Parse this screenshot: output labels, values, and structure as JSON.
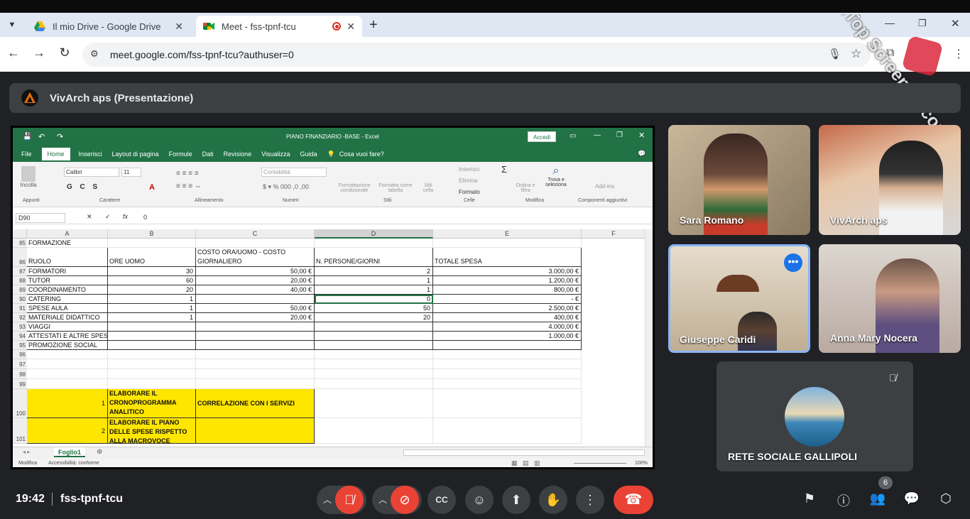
{
  "browser": {
    "tabs": [
      {
        "title": "Il mio Drive - Google Drive"
      },
      {
        "title": "Meet - fss-tpnf-tcu"
      }
    ],
    "url": "meet.google.com/fss-tpnf-tcu?authuser=0",
    "watermark": "iTop Screen Recorder"
  },
  "meet": {
    "presentation_title": "VivArch aps (Presentazione)",
    "time": "19:42",
    "meeting_code": "fss-tpnf-tcu",
    "participants_count": "6",
    "participants": [
      {
        "name": "Sara Romano"
      },
      {
        "name": "VivArch aps"
      },
      {
        "name": "Giuseppe Caridi"
      },
      {
        "name": "Anna Mary Nocera"
      },
      {
        "name": "RETE SOCIALE GALLIPOLI"
      }
    ]
  },
  "excel": {
    "title": "PIANO FINANZIARIO -BASE  -  Excel",
    "sign_in": "Accedi",
    "menu": [
      "File",
      "Home",
      "Inserisci",
      "Layout di pagina",
      "Formule",
      "Dati",
      "Revisione",
      "Visualizza",
      "Guida"
    ],
    "tell_me": "Cosa vuoi fare?",
    "ribbon": {
      "paste": "Incolla",
      "font_name": "Calibri",
      "font_size": "11",
      "number_format": "Contabilità",
      "cond_format": "Formattazione condizionale",
      "format_table": "Formatta come tabella",
      "cell_styles": "Stili cella",
      "insert": "Inserisci",
      "delete": "Elimina",
      "format": "Formato",
      "sort_filter": "Ordina e filtra",
      "find_select": "Trova e seleziona",
      "addins": "Add-ins",
      "groups": [
        "Appunti",
        "Carattere",
        "Allineamento",
        "Numeri",
        "Stili",
        "Celle",
        "Modifica",
        "Componenti aggiuntivi"
      ]
    },
    "name_box": "D90",
    "formula": "0",
    "columns": [
      "A",
      "B",
      "C",
      "D",
      "E",
      "F"
    ],
    "rows": [
      {
        "n": "85",
        "a": "FORMAZIONE",
        "b": "",
        "c": "",
        "d": "",
        "e": ""
      },
      {
        "n": "86",
        "a": "RUOLO",
        "b": "ORE UOMO",
        "c": "COSTO ORA/UOMO - COSTO GIORNALIERO",
        "d": "N. PERSONE/GIORNI",
        "e": "TOTALE SPESA"
      },
      {
        "n": "87",
        "a": "FORMATORI",
        "b": "30",
        "c": "50,00 €",
        "d": "2",
        "e": "3.000,00 €"
      },
      {
        "n": "88",
        "a": "TUTOR",
        "b": "60",
        "c": "20,00 €",
        "d": "1",
        "e": "1.200,00 €"
      },
      {
        "n": "89",
        "a": "COORDINAMENTO",
        "b": "20",
        "c": "40,00 €",
        "d": "1",
        "e": "800,00 €"
      },
      {
        "n": "90",
        "a": "CATERING",
        "b": "1",
        "c": "",
        "d": "0",
        "e": "-     €"
      },
      {
        "n": "91",
        "a": "SPESE AULA",
        "b": "1",
        "c": "50,00 €",
        "d": "50",
        "e": "2.500,00 €"
      },
      {
        "n": "92",
        "a": "MATERIALE DIDATTICO",
        "b": "1",
        "c": "20,00 €",
        "d": "20",
        "e": "400,00 €"
      },
      {
        "n": "93",
        "a": "VIAGGI",
        "b": "",
        "c": "",
        "d": "",
        "e": "4.000,00 €"
      },
      {
        "n": "94",
        "a": "ATTESTATI E ALTRE SPESE",
        "b": "",
        "c": "",
        "d": "",
        "e": "1.000,00 €"
      },
      {
        "n": "95",
        "a": "PROMOZIONE SOCIAL",
        "b": "",
        "c": "",
        "d": "",
        "e": ""
      },
      {
        "n": "96"
      },
      {
        "n": "97"
      },
      {
        "n": "98"
      },
      {
        "n": "99"
      },
      {
        "n": "100",
        "a": "1",
        "b": "ELABORARE IL CRONOPROGRAMMA ANALITICO",
        "c": "CORRELAZIONE CON I SERVIZI"
      },
      {
        "n": "101",
        "a": "2",
        "b": "ELABORARE IL PIANO DELLE SPESE RISPETTO ALLA MACROVOCE"
      }
    ],
    "sheet_tab": "Foglio1",
    "status_mode": "Modifica",
    "accessibility": "Accessibilità: conforme",
    "zoom": "100%"
  }
}
